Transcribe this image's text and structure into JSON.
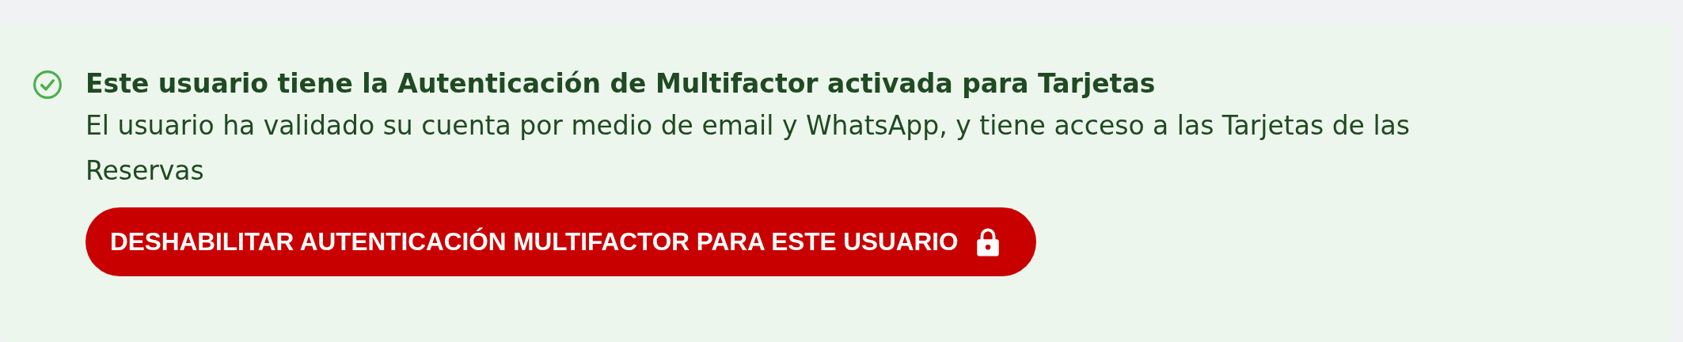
{
  "alert": {
    "kind": "success",
    "title": "Este usuario tiene la Autenticación de Multifactor activada para Tarjetas",
    "message": "El usuario ha validado su cuenta por medio de email y WhatsApp, y tiene acceso a las Tarjetas de las Reservas",
    "button": {
      "label": "DESHABILITAR AUTENTICACIÓN MULTIFACTOR PARA ESTE USUARIO"
    }
  }
}
